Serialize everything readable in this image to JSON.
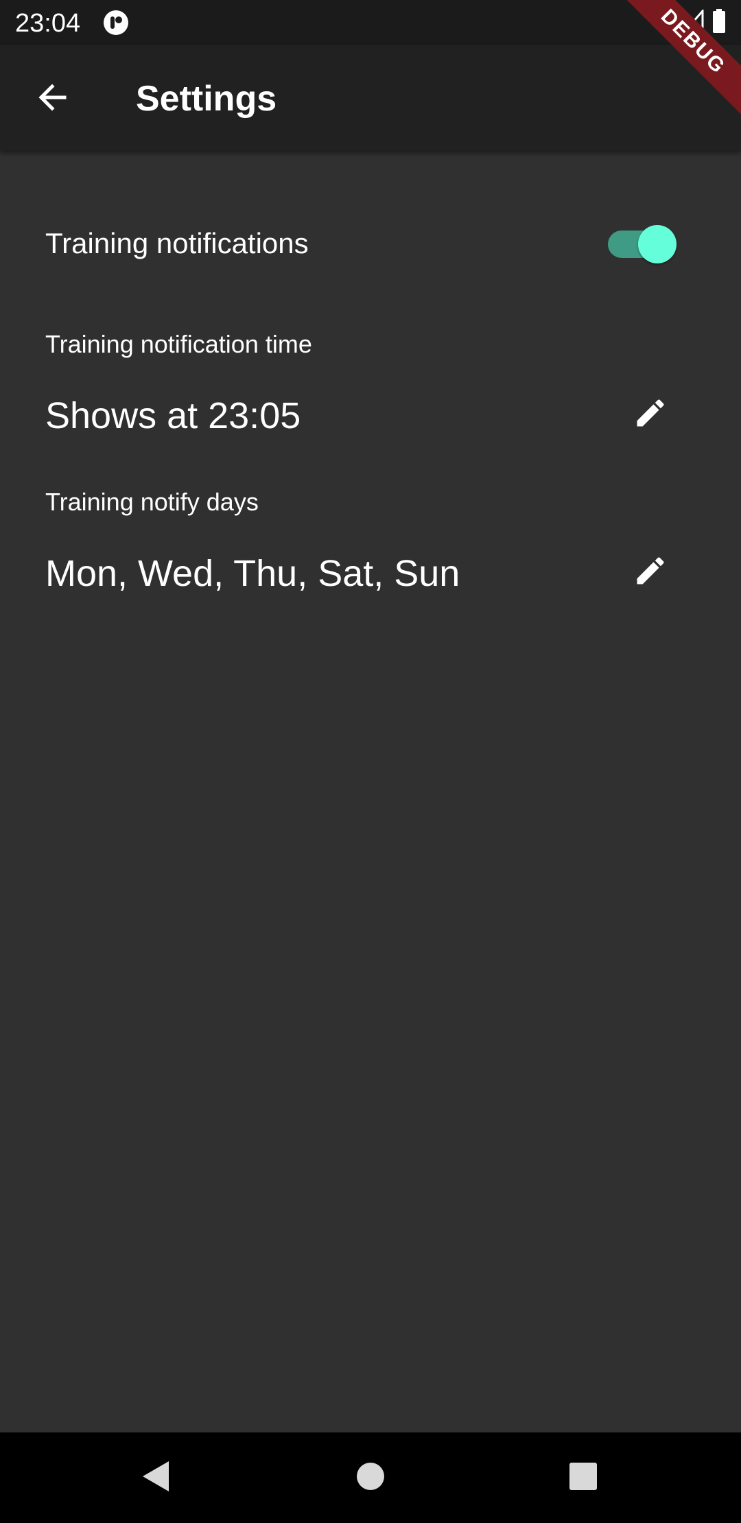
{
  "status_bar": {
    "time": "23:04",
    "icons": [
      "app-notification-icon",
      "wifi-icon",
      "signal-icon",
      "battery-icon"
    ]
  },
  "debug_banner": {
    "label": "DEBUG",
    "color": "#7a1a1e"
  },
  "app_bar": {
    "title": "Settings",
    "back_icon": "arrow-back-icon"
  },
  "settings": {
    "training_notifications": {
      "label": "Training notifications",
      "enabled": true,
      "accent_color": "#64ffda"
    },
    "notification_time": {
      "caption": "Training notification time",
      "value": "Shows at 23:05",
      "edit_icon": "pencil-icon"
    },
    "notify_days": {
      "caption": "Training notify days",
      "value": "Mon, Wed, Thu, Sat, Sun",
      "edit_icon": "pencil-icon"
    }
  },
  "nav_bar": {
    "icons": [
      "back-triangle-icon",
      "home-circle-icon",
      "recents-square-icon"
    ]
  },
  "colors": {
    "background": "#303030",
    "app_bar": "#212121",
    "status_bar": "#1b1b1b",
    "nav_bar": "#000000"
  }
}
